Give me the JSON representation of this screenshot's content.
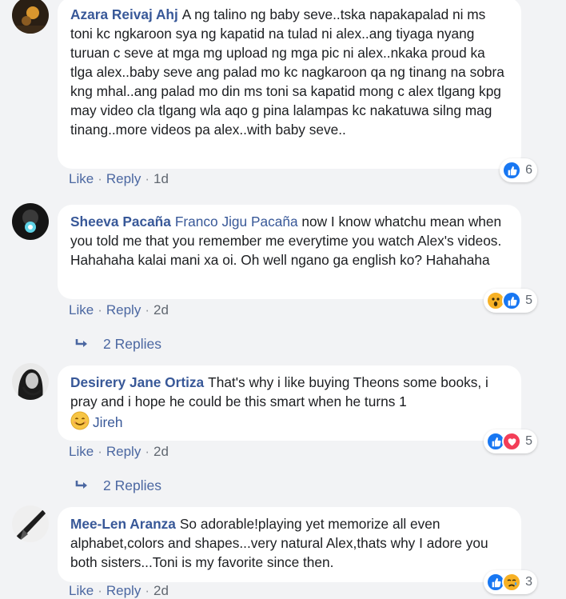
{
  "comments": [
    {
      "author": "Azara Reivaj Ahj",
      "mention": "",
      "text": "A ng talino ng baby seve..tska napakapalad ni ms toni kc ngkaroon sya ng kapatid na tulad ni alex..ang tiyaga nyang turuan c seve at mga mg upload ng mga pic ni alex..nkaka proud ka tlga alex..baby seve ang palad mo kc nagkaroon qa ng tinang na sobra kng mhal..ang palad mo din ms toni sa kapatid mong c alex tlgang kpg may video cla tlgang wla aqo g pina lalampas kc nakatuwa silng mag tinang..more videos pa alex..with baby seve..",
      "like": "Like",
      "reply": "Reply",
      "time": "1d",
      "reaction_count": "6"
    },
    {
      "author": "Sheeva Pacaña",
      "mention": "Franco Jigu Pacaña",
      "text": "now I know whatchu mean when you told me that you remember me everytime you watch Alex's videos. Hahahaha kalai mani xa oi. Oh well ngano ga english ko? Hahahaha",
      "like": "Like",
      "reply": "Reply",
      "time": "2d",
      "reaction_count": "5",
      "replies": "2 Replies"
    },
    {
      "author": "Desirery Jane Ortiza",
      "mention": "",
      "text": "That's why i like buying Theons some books, i pray and i hope he could be this smart when he turns 1",
      "mention_after": "Jireh",
      "like": "Like",
      "reply": "Reply",
      "time": "2d",
      "reaction_count": "5",
      "replies": "2 Replies"
    },
    {
      "author": "Mee-Len Aranza",
      "mention": "",
      "text": "So adorable!playing yet memorize all even alphabet,colors and shapes...very natural Alex,thats why I adore you both sisters...Toni is my favorite since then.",
      "like": "Like",
      "reply": "Reply",
      "time": "2d",
      "reaction_count": "3"
    }
  ],
  "colors": {
    "link": "#385898",
    "like_blue": "#1877f2",
    "love_red": "#f33e58",
    "wow_yellow": "#f7b125"
  },
  "icons": {
    "like": "thumbs-up-icon",
    "love": "heart-icon",
    "wow": "wow-face-icon",
    "sad": "sad-face-icon",
    "smile": "smile-emoji-icon",
    "reply_arrow": "reply-arrow-icon"
  }
}
